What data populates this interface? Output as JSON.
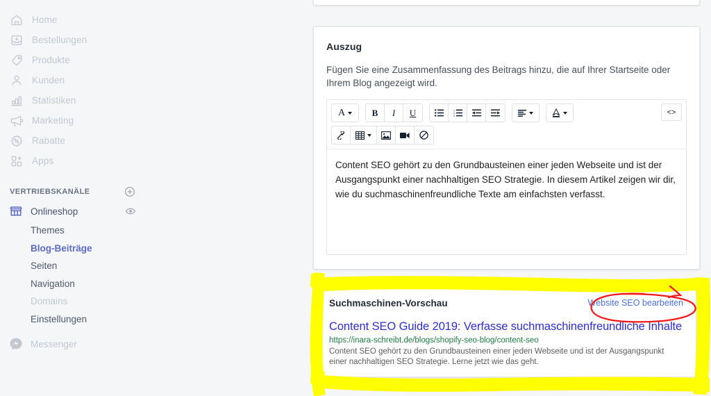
{
  "sidebar": {
    "nav_items": [
      {
        "label": "Home",
        "icon": "home-icon"
      },
      {
        "label": "Bestellungen",
        "icon": "orders-inbox-icon"
      },
      {
        "label": "Produkte",
        "icon": "product-tag-icon"
      },
      {
        "label": "Kunden",
        "icon": "customer-person-icon"
      },
      {
        "label": "Statistiken",
        "icon": "bar-chart-icon"
      },
      {
        "label": "Marketing",
        "icon": "megaphone-icon"
      },
      {
        "label": "Rabatte",
        "icon": "discount-badge-icon"
      },
      {
        "label": "Apps",
        "icon": "apps-grid-plus-icon"
      }
    ],
    "section": {
      "title": "VERTRIEBSKANÄLE",
      "add_icon": "plus-circle-icon"
    },
    "channel": {
      "label": "Onlineshop",
      "icon": "storefront-icon",
      "view_icon": "eye-icon"
    },
    "sub_items": [
      {
        "label": "Themes",
        "state": "normal"
      },
      {
        "label": "Blog-Beiträge",
        "state": "active"
      },
      {
        "label": "Seiten",
        "state": "normal"
      },
      {
        "label": "Navigation",
        "state": "normal"
      },
      {
        "label": "Domains",
        "state": "dim"
      },
      {
        "label": "Einstellungen",
        "state": "normal"
      }
    ],
    "messenger": {
      "label": "Messenger",
      "icon": "messenger-bubble-icon"
    },
    "active_color": "#5c6ac4"
  },
  "excerpt_card": {
    "title": "Auszug",
    "help_text": "Fügen Sie eine Zusammenfassung des Beitrags hinzu, die auf Ihrer Startseite oder Ihrem Blog angezeigt wird.",
    "toolbar_row1": [
      {
        "icon": "font-family-icon",
        "glyph": "A",
        "caret": true
      },
      {
        "icon": "bold-icon",
        "glyph": "B",
        "caret": false
      },
      {
        "icon": "italic-icon",
        "glyph": "I",
        "caret": false
      },
      {
        "icon": "underline-icon",
        "glyph": "U",
        "caret": false
      },
      {
        "icon": "unordered-list-icon",
        "glyph": "≔",
        "caret": false
      },
      {
        "icon": "ordered-list-icon",
        "glyph": "≕",
        "caret": false
      },
      {
        "icon": "outdent-icon",
        "glyph": "⇤",
        "caret": false
      },
      {
        "icon": "indent-icon",
        "glyph": "⇥",
        "caret": false
      },
      {
        "icon": "align-icon",
        "glyph": "≡",
        "caret": true
      },
      {
        "icon": "text-color-icon",
        "glyph": "A",
        "caret": true
      }
    ],
    "toolbar_row2": [
      {
        "icon": "link-icon",
        "glyph": "🔗"
      },
      {
        "icon": "table-icon",
        "glyph": "▦",
        "caret": true
      },
      {
        "icon": "image-icon",
        "glyph": "🖼"
      },
      {
        "icon": "video-icon",
        "glyph": "▶"
      },
      {
        "icon": "clear-formatting-icon",
        "glyph": "⊘"
      }
    ],
    "code_view": {
      "icon": "code-view-icon",
      "glyph": "<>"
    },
    "body_text": "Content SEO gehört zu den Grundbausteinen einer jeden Webseite und ist der Ausgangspunkt einer nachhaltigen SEO Strategie. In diesem Artikel zeigen wir dir, wie du suchmaschinenfreundliche Texte am einfachsten verfasst."
  },
  "serp_card": {
    "heading": "Suchmaschinen-Vorschau",
    "edit_link": "Website SEO bearbeiten",
    "result_title": "Content SEO Guide 2019: Verfasse suchmaschinenfreundliche Inhalte",
    "result_url": "https://inara-schreibt.de/blogs/shopify-seo-blog/content-seo",
    "result_description": "Content SEO gehört zu den Grundbausteinen einer jeden Webseite und ist der Ausgangspunkt einer nachhaltigen SEO Strategie. Lerne jetzt wie das geht.",
    "title_color": "#2d2ec9",
    "url_color": "#1d7a3f",
    "link_color": "#4a72d4"
  },
  "annotations": {
    "highlight_color": "#ffff00",
    "circle_color": "#f41818",
    "highlight_target": "Suchmaschinen-Vorschau card",
    "circle_target": "Website SEO bearbeiten"
  }
}
